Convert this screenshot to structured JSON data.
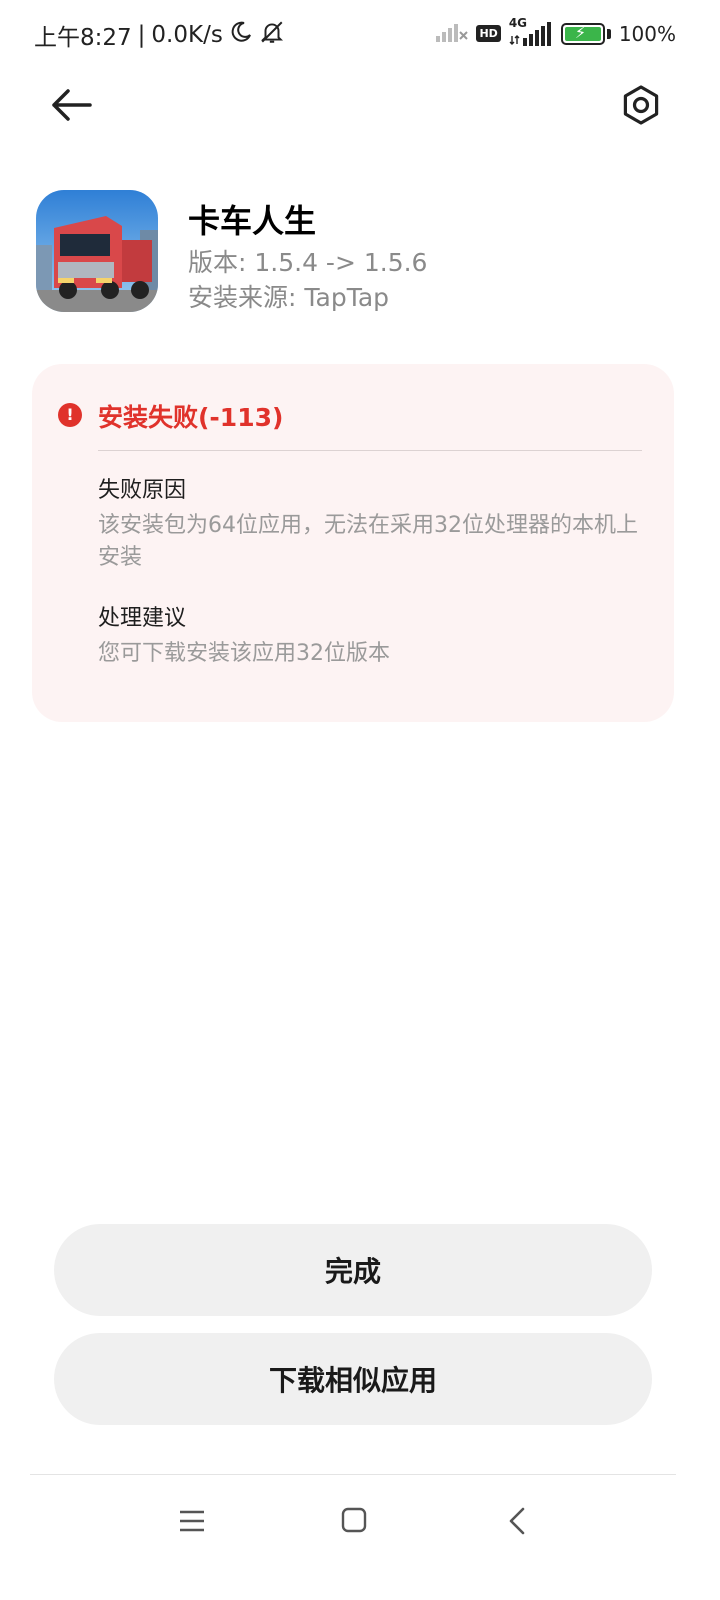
{
  "status_bar": {
    "time": "上午8:27",
    "separator": "|",
    "net_speed": "0.0K/s",
    "hd_label": "HD",
    "network_label": "4G",
    "battery_text": "100%",
    "battery_level": 1.0,
    "icons": [
      "moon-icon",
      "bell-off-icon",
      "signal-off-icon",
      "signal-icon",
      "battery-charging-icon"
    ]
  },
  "nav": {
    "back_icon": "arrow-left-icon",
    "settings_icon": "settings-hex-icon"
  },
  "app": {
    "name": "卡车人生",
    "version": "版本: 1.5.4 -> 1.5.6",
    "source": "安装来源: TapTap",
    "icon": "truck-app-icon"
  },
  "error": {
    "title": "安装失败(-113)",
    "icon_glyph": "!",
    "reason_label": "失败原因",
    "reason_text": "该安装包为64位应用，无法在采用32位处理器的本机上安装",
    "advice_label": "处理建议",
    "advice_text": "您可下载安装该应用32位版本",
    "color": "#e0322b"
  },
  "buttons": {
    "done": "完成",
    "similar": "下载相似应用"
  },
  "system_nav": {
    "icons": [
      "menu-icon",
      "home-icon",
      "back-icon"
    ]
  }
}
